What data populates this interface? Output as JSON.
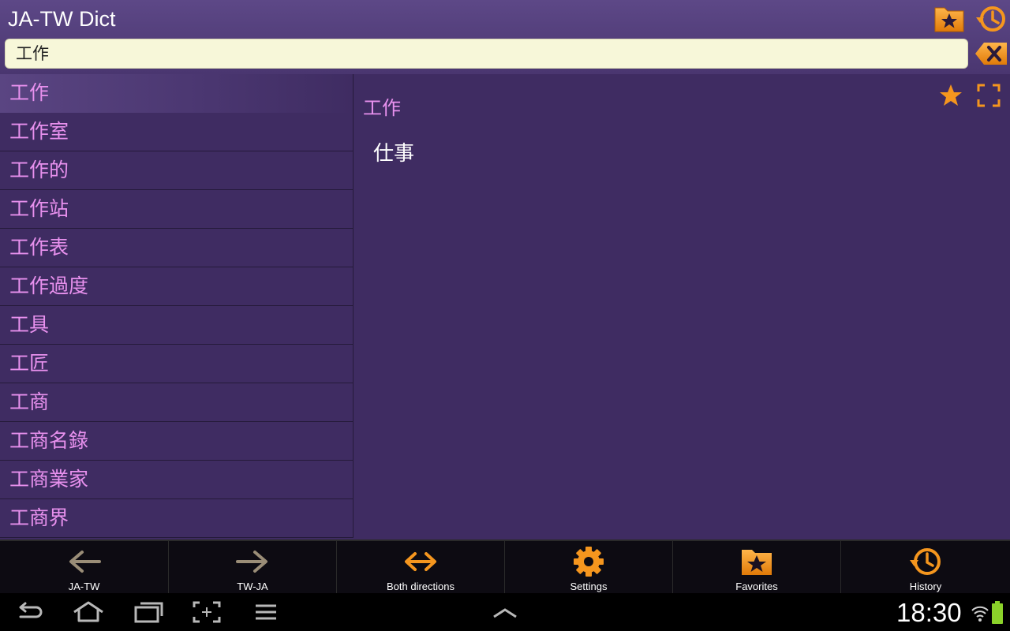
{
  "header": {
    "title": "JA-TW Dict",
    "favorites_icon": "favorites-folder-star-icon",
    "history_icon": "history-clock-icon"
  },
  "search": {
    "value": "工作",
    "clear_icon": "backspace-clear-icon"
  },
  "word_list": {
    "items": [
      {
        "label": "工作",
        "selected": true
      },
      {
        "label": "工作室"
      },
      {
        "label": "工作的"
      },
      {
        "label": "工作站"
      },
      {
        "label": "工作表"
      },
      {
        "label": "工作過度"
      },
      {
        "label": "工具"
      },
      {
        "label": "工匠"
      },
      {
        "label": "工商"
      },
      {
        "label": "工商名錄"
      },
      {
        "label": "工商業家"
      },
      {
        "label": "工商界"
      }
    ]
  },
  "detail": {
    "word": "工作",
    "meaning": "仕事",
    "star_icon": "star-icon",
    "fullscreen_icon": "fullscreen-icon"
  },
  "toolbar": {
    "items": [
      {
        "label": "JA-TW",
        "icon": "arrow-left-icon"
      },
      {
        "label": "TW-JA",
        "icon": "arrow-right-icon"
      },
      {
        "label": "Both directions",
        "icon": "arrow-both-icon"
      },
      {
        "label": "Settings",
        "icon": "gear-icon"
      },
      {
        "label": "Favorites",
        "icon": "favorites-folder-star-icon"
      },
      {
        "label": "History",
        "icon": "history-clock-icon"
      }
    ]
  },
  "system_bar": {
    "clock": "18:30",
    "buttons": [
      "back-icon",
      "home-icon",
      "recent-apps-icon",
      "screenshot-icon",
      "menu-icon",
      "chevron-up-icon"
    ]
  },
  "colors": {
    "background": "#3f2c62",
    "accent": "#f5961e",
    "word_text": "#e891ee"
  }
}
